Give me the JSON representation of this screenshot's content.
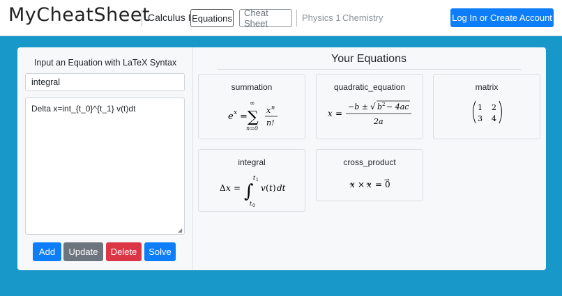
{
  "navbar": {
    "logo": "MyCheatSheet",
    "course": "Calculus II",
    "equations_btn": "Equations",
    "cheatsheet_btn": "Cheat Sheet",
    "links": [
      "Physics 1",
      "Chemistry"
    ],
    "login": "Log In or Create Account"
  },
  "editor": {
    "title": "Input an Equation with LaTeX Syntax",
    "name_value": "integral",
    "latex_value": "Delta x=int_{t_0}^{t_1} v(t)dt",
    "buttons": {
      "add": "Add",
      "update": "Update",
      "delete": "Delete",
      "solve": "Solve"
    }
  },
  "equations": {
    "title": "Your Equations",
    "items": [
      {
        "name": "summation"
      },
      {
        "name": "quadratic_equation"
      },
      {
        "name": "matrix"
      },
      {
        "name": "integral"
      },
      {
        "name": "cross_product"
      }
    ]
  },
  "colors": {
    "background": "#1897c9",
    "primary": "#0d7ef8",
    "secondary": "#6c757d",
    "danger": "#dc3545"
  }
}
